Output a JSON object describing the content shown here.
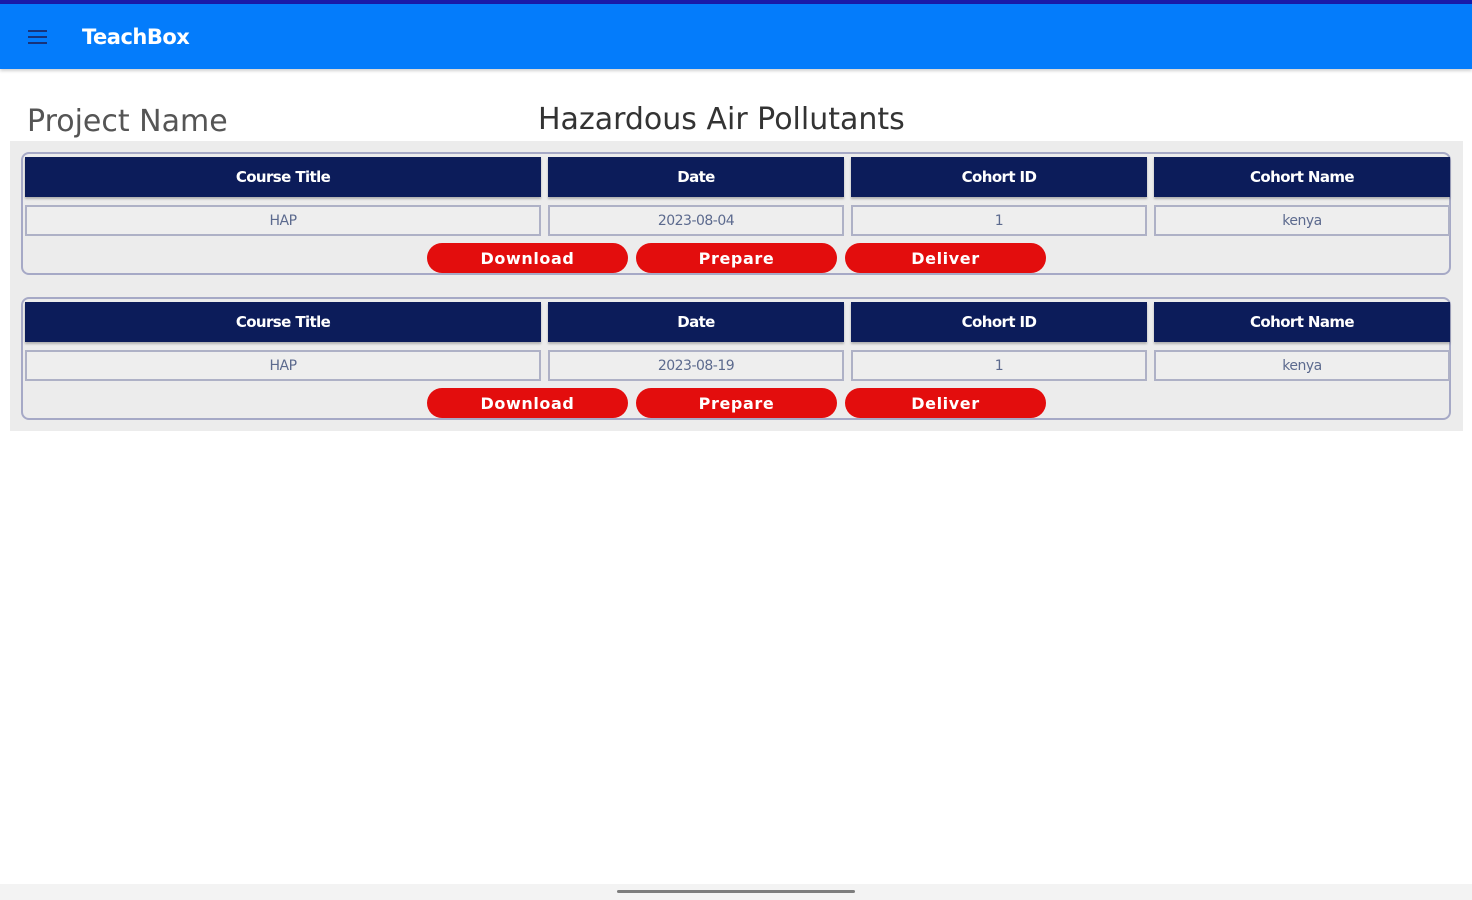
{
  "app": {
    "title": "TeachBox",
    "menu_icon": "hamburger-menu-icon"
  },
  "project": {
    "label": "Project Name",
    "value": "Hazardous Air Pollutants"
  },
  "colors": {
    "appbar": "#047cfb",
    "header_cell": "#0c1c5a",
    "button": "#e30d0d"
  },
  "courses": [
    {
      "headers": [
        "Course Title",
        "Date",
        "Cohort ID",
        "Cohort Name"
      ],
      "values": [
        "HAP",
        "2023-08-04",
        "1",
        "kenya"
      ],
      "buttons": [
        "Download",
        "Prepare",
        "Deliver"
      ]
    },
    {
      "headers": [
        "Course Title",
        "Date",
        "Cohort ID",
        "Cohort Name"
      ],
      "values": [
        "HAP",
        "2023-08-19",
        "1",
        "kenya"
      ],
      "buttons": [
        "Download",
        "Prepare",
        "Deliver"
      ]
    }
  ]
}
